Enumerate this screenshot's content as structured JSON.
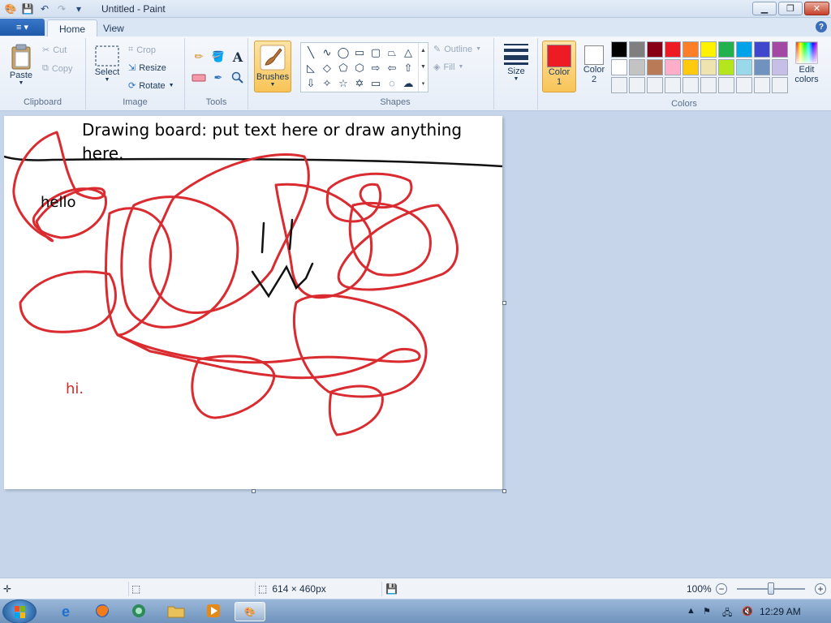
{
  "window": {
    "title": "Untitled - Paint",
    "minimize_icon": "minimize-icon",
    "maximize_icon": "restore-icon",
    "close_label": "✕"
  },
  "tabs": {
    "file_label": "≡ ▾",
    "home": "Home",
    "view": "View",
    "help": "?"
  },
  "ribbon": {
    "clipboard": {
      "group_label": "Clipboard",
      "paste": "Paste",
      "cut": "Cut",
      "copy": "Copy"
    },
    "image": {
      "group_label": "Image",
      "select": "Select",
      "crop": "Crop",
      "resize": "Resize",
      "rotate": "Rotate"
    },
    "tools": {
      "group_label": "Tools",
      "items": [
        "pencil-icon",
        "fill-icon",
        "text-icon",
        "eraser-icon",
        "color-picker-icon",
        "magnifier-icon"
      ]
    },
    "brushes": {
      "label": "Brushes"
    },
    "shapes": {
      "group_label": "Shapes",
      "outline": "Outline",
      "fill": "Fill"
    },
    "size": {
      "label": "Size"
    },
    "colors": {
      "group_label": "Colors",
      "color1_label": "Color",
      "color1_num": "1",
      "color2_label": "Color",
      "color2_num": "2",
      "edit_line1": "Edit",
      "edit_line2": "colors",
      "color1": "#ed1c24",
      "color2": "#ffffff",
      "palette": [
        "#000000",
        "#7f7f7f",
        "#880015",
        "#ed1c24",
        "#ff7f27",
        "#fff200",
        "#22b14c",
        "#00a2e8",
        "#3f48cc",
        "#a349a4",
        "#ffffff",
        "#c3c3c3",
        "#b97a57",
        "#ffaec9",
        "#ffc90e",
        "#efe4b0",
        "#b5e61d",
        "#99d9ea",
        "#7092be",
        "#c8bfe7",
        "#eef1f6",
        "#eef1f6",
        "#eef1f6",
        "#eef1f6",
        "#eef1f6",
        "#eef1f6",
        "#eef1f6",
        "#eef1f6",
        "#eef1f6",
        "#eef1f6"
      ]
    }
  },
  "canvas": {
    "title_text": "Drawing board: put text here or draw anything here.",
    "hello": "hello",
    "hi": "hi.",
    "stroke_color": "#d92b30"
  },
  "status": {
    "dimensions": "614 × 460px",
    "zoom": "100%",
    "zoom_minus": "−",
    "zoom_plus": "+"
  },
  "taskbar": {
    "clock": "12:29 AM"
  }
}
